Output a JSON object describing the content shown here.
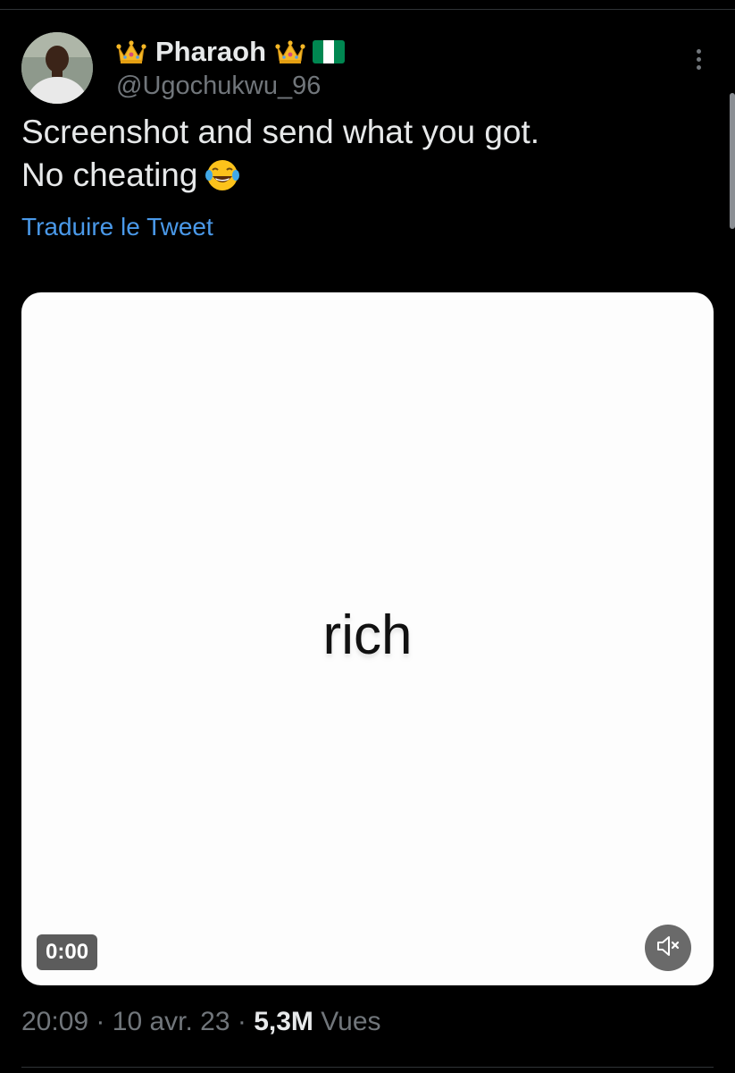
{
  "tweet": {
    "author": {
      "display_name": "Pharaoh",
      "handle": "@Ugochukwu_96",
      "name_icons": [
        "crown-icon",
        "crown-icon",
        "nigeria-flag-icon"
      ]
    },
    "text_lines": [
      "Screenshot and send what you got.",
      "No cheating"
    ],
    "text_emoji": "face-with-tears-of-joy-icon",
    "translate_label": "Traduire le Tweet",
    "media": {
      "caption_word": "rich",
      "duration": "0:00",
      "mute_icon": "speaker-muted-icon"
    },
    "meta": {
      "time": "20:09",
      "separator": "·",
      "date": "10 avr. 23",
      "views_count": "5,3M",
      "views_label": "Vues"
    }
  },
  "colors": {
    "background": "#000000",
    "primary_text": "#e7e9ea",
    "secondary_text": "#71767b",
    "link": "#4a99e9",
    "flag_green": "#008751"
  }
}
